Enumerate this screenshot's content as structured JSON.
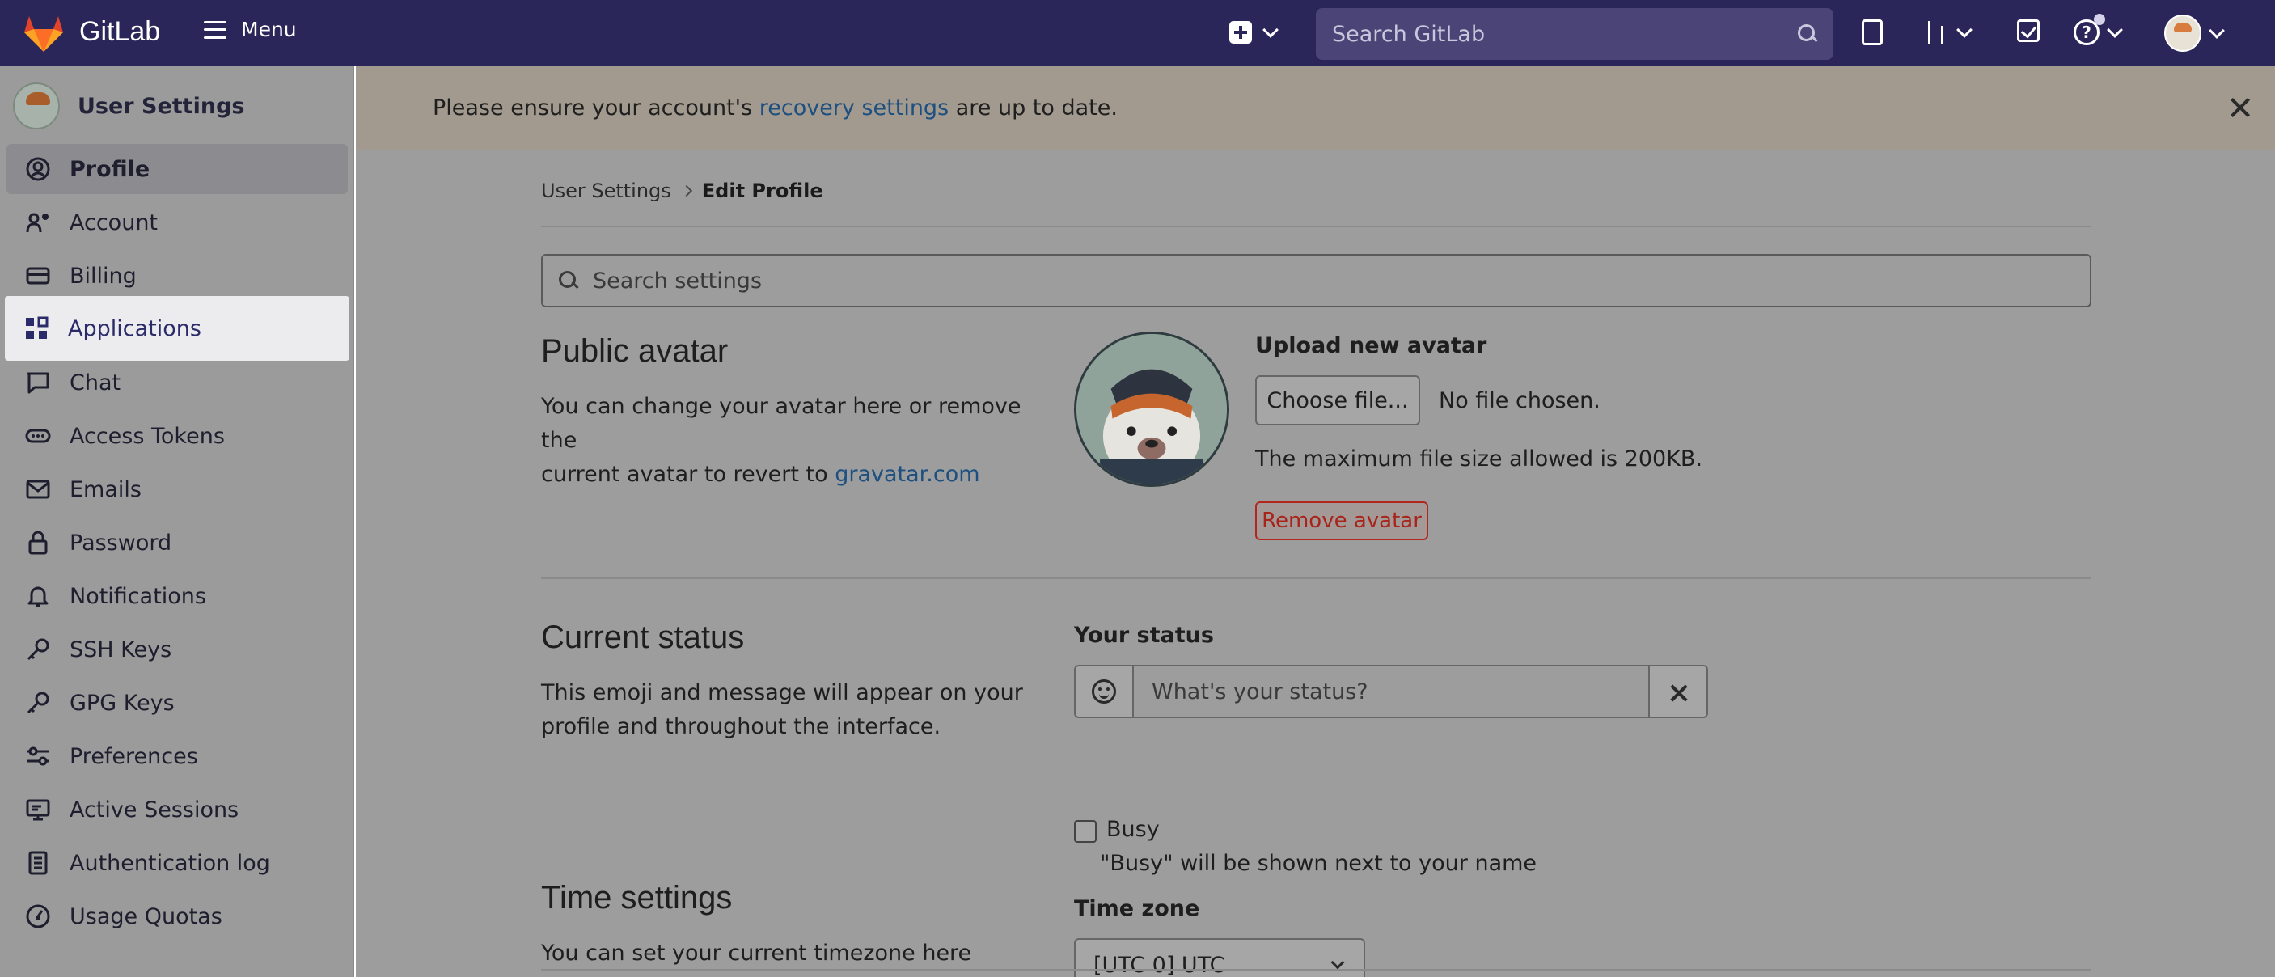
{
  "topbar": {
    "brand": "GitLab",
    "menu_label": "Menu",
    "search_placeholder": "Search GitLab"
  },
  "sidebar": {
    "title": "User Settings",
    "items": [
      {
        "label": "Profile",
        "icon": "profile-icon"
      },
      {
        "label": "Account",
        "icon": "account-icon"
      },
      {
        "label": "Billing",
        "icon": "billing-icon"
      },
      {
        "label": "Applications",
        "icon": "applications-icon"
      },
      {
        "label": "Chat",
        "icon": "chat-icon"
      },
      {
        "label": "Access Tokens",
        "icon": "token-icon"
      },
      {
        "label": "Emails",
        "icon": "mail-icon"
      },
      {
        "label": "Password",
        "icon": "lock-icon"
      },
      {
        "label": "Notifications",
        "icon": "bell-icon"
      },
      {
        "label": "SSH Keys",
        "icon": "key-icon"
      },
      {
        "label": "GPG Keys",
        "icon": "key-icon"
      },
      {
        "label": "Preferences",
        "icon": "preferences-icon"
      },
      {
        "label": "Active Sessions",
        "icon": "monitor-icon"
      },
      {
        "label": "Authentication log",
        "icon": "log-icon"
      },
      {
        "label": "Usage Quotas",
        "icon": "quota-icon"
      }
    ]
  },
  "banner": {
    "text_before": "Please ensure your account's ",
    "link": "recovery settings",
    "text_after": " are up to date."
  },
  "breadcrumb": {
    "parent": "User Settings",
    "current": "Edit Profile"
  },
  "settings_search": {
    "placeholder": "Search settings"
  },
  "avatar_section": {
    "title": "Public avatar",
    "desc_line1": "You can change your avatar here or remove the",
    "desc_line2_prefix": "current avatar to revert to ",
    "desc_link": "gravatar.com",
    "upload_label": "Upload new avatar",
    "choose_file_label": "Choose file...",
    "no_file_text": "No file chosen.",
    "max_size_text": "The maximum file size allowed is 200KB.",
    "remove_label": "Remove avatar"
  },
  "status_section": {
    "title": "Current status",
    "desc_line1": "This emoji and message will appear on your",
    "desc_line2": "profile and throughout the interface.",
    "your_status_label": "Your status",
    "status_placeholder": "What's your status?",
    "busy_label": "Busy",
    "busy_help": "\"Busy\" will be shown next to your name"
  },
  "time_section": {
    "title": "Time settings",
    "desc": "You can set your current timezone here",
    "timezone_label": "Time zone",
    "timezone_value": "[UTC 0] UTC"
  }
}
